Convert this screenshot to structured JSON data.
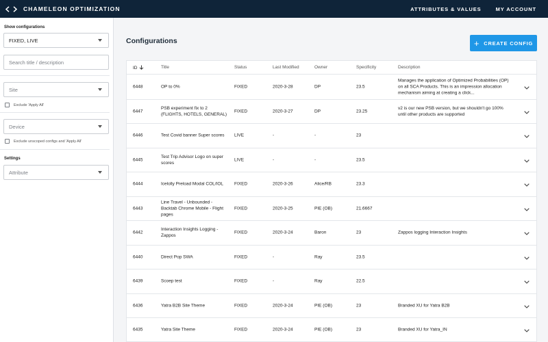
{
  "app": {
    "title": "CHAMELEON OPTIMIZATION",
    "logo_icon": "code-brackets-icon"
  },
  "nav": {
    "attributes_values": "ATTRIBUTES & VALUES",
    "my_account": "MY ACCOUNT"
  },
  "sidebar": {
    "show_configurations_label": "Show configurations",
    "config_filter_value": "FIXED, LIVE",
    "search_placeholder": "Search title / description",
    "site_placeholder": "Site",
    "exclude_apply_all": "Exclude 'Apply All'",
    "device_placeholder": "Device",
    "exclude_unscoped": "Exclude unscoped configs and 'Apply All'",
    "settings_label": "Settings",
    "attribute_placeholder": "Attribute"
  },
  "main": {
    "title": "Configurations",
    "create_button": "CREATE CONFIG",
    "columns": {
      "id": "ID",
      "title": "Title",
      "status": "Status",
      "last_modified": "Last Modified",
      "owner": "Owner",
      "specificity": "Specificity",
      "description": "Description"
    },
    "rows": [
      {
        "id": "6448",
        "title": "OP to 0%",
        "status": "FIXED",
        "modified": "2020-3-28",
        "owner": "DP",
        "spec": "23.5",
        "desc": "Manages the application of Optimized Probabilities (OP) on all SCA Products. This is an impression allocation mechanism aiming at creating a click..."
      },
      {
        "id": "6447",
        "title": "PSB experiment fix to 2 (FLIGHTS, HOTELS, GENERAL)",
        "status": "FIXED",
        "modified": "2020-3-27",
        "owner": "DP",
        "spec": "23.25",
        "desc": "v2 is our new PSB version, but we shouldn't go 100% until other products are supported"
      },
      {
        "id": "6446",
        "title": "Test Covid banner Super scores",
        "status": "LIVE",
        "modified": "-",
        "owner": "-",
        "spec": "23",
        "desc": ""
      },
      {
        "id": "6445",
        "title": "Test Trip Advisor Logo on super scores",
        "status": "LIVE",
        "modified": "-",
        "owner": "-",
        "spec": "23.5",
        "desc": ""
      },
      {
        "id": "6444",
        "title": "Icelolly Preload Modal COL/IOL",
        "status": "FIXED",
        "modified": "2020-3-26",
        "owner": "Alice/RB",
        "spec": "23.3",
        "desc": ""
      },
      {
        "id": "6443",
        "title": "Line Travel - Unbounded - Backtab Chrome Mobile - Flight pages",
        "status": "FIXED",
        "modified": "2020-3-25",
        "owner": "PIE (OB)",
        "spec": "21.6667",
        "desc": ""
      },
      {
        "id": "6442",
        "title": "Interaction Insights Logging - Zappos",
        "status": "FIXED",
        "modified": "2020-3-24",
        "owner": "Baron",
        "spec": "23",
        "desc": "Zappos logging Interaction Insights"
      },
      {
        "id": "6440",
        "title": "Direct Pop SWA",
        "status": "FIXED",
        "modified": "-",
        "owner": "Ray",
        "spec": "23.5",
        "desc": ""
      },
      {
        "id": "6439",
        "title": "Scoep test",
        "status": "FIXED",
        "modified": "-",
        "owner": "Ray",
        "spec": "22.5",
        "desc": ""
      },
      {
        "id": "6436",
        "title": "Yatra B2B Site Theme",
        "status": "FIXED",
        "modified": "2020-3-24",
        "owner": "PIE (OB)",
        "spec": "23",
        "desc": "Branded XU for Yatra B2B"
      },
      {
        "id": "6435",
        "title": "Yatra Site Theme",
        "status": "FIXED",
        "modified": "2020-3-24",
        "owner": "PIE (OB)",
        "spec": "23",
        "desc": "Branded XU for Yatra_IN"
      }
    ]
  },
  "colors": {
    "topbar": "#0f2439",
    "accent": "#1f97e7",
    "background": "#f4f5f7"
  }
}
